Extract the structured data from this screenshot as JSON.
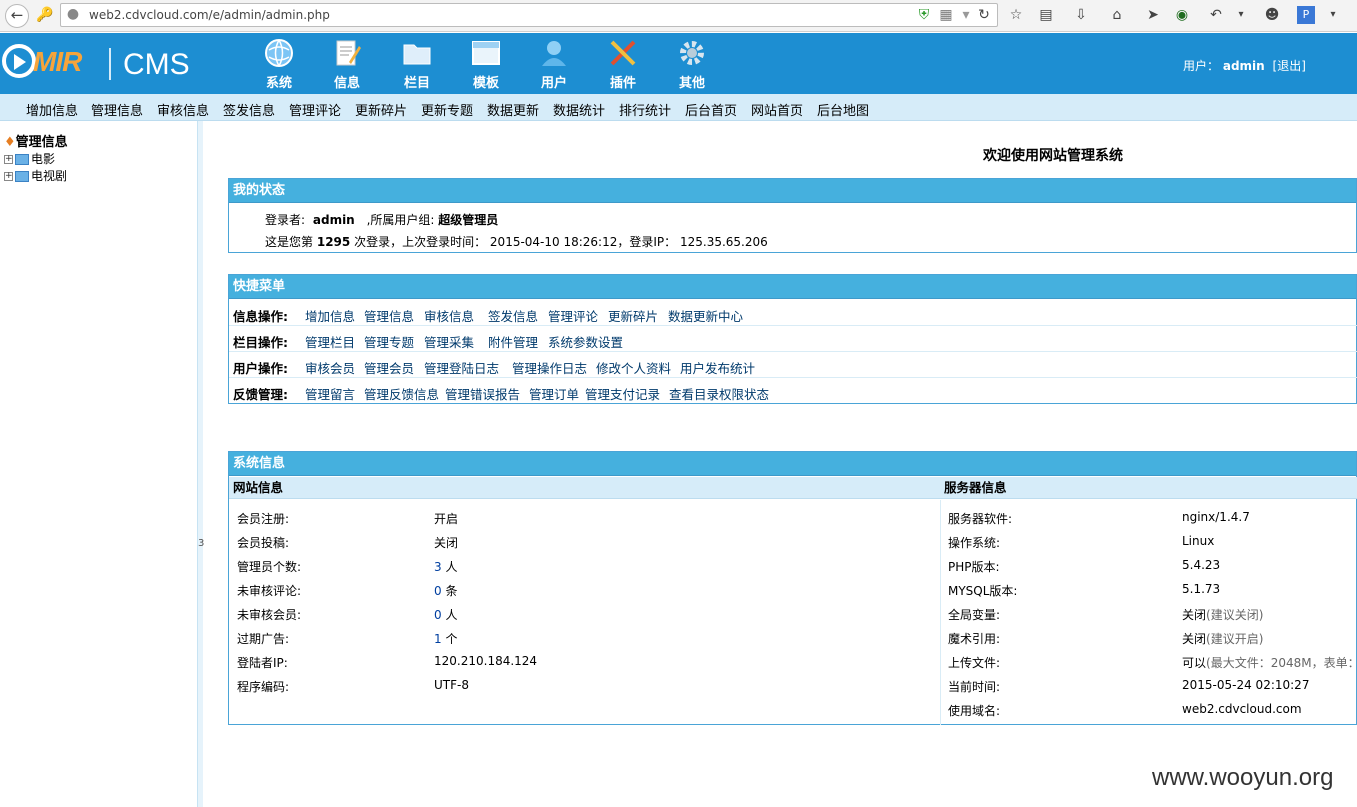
{
  "browser": {
    "url": "web2.cdvcloud.com/e/admin/admin.php",
    "back_icon": "back-arrow-icon",
    "icons": [
      "key-icon",
      "globe-icon",
      "shield-icon",
      "qrcode-icon",
      "dropdown-icon",
      "refresh-icon",
      "star-icon",
      "reader-icon",
      "download-icon",
      "home-icon",
      "send-icon",
      "extension-icon",
      "undo-icon",
      "dropdown-icon",
      "user-icon",
      "pinyin-icon",
      "menu-icon"
    ]
  },
  "header": {
    "logo_text": "MIR",
    "logo_cms": "CMS",
    "menus": [
      {
        "label": "系统",
        "icon": "globe-icon"
      },
      {
        "label": "信息",
        "icon": "document-edit-icon"
      },
      {
        "label": "栏目",
        "icon": "folder-icon"
      },
      {
        "label": "模板",
        "icon": "window-icon"
      },
      {
        "label": "用户",
        "icon": "user-icon"
      },
      {
        "label": "插件",
        "icon": "tools-icon"
      },
      {
        "label": "其他",
        "icon": "gear-icon"
      }
    ],
    "user_label": "用户：",
    "user_name": "admin",
    "logout": "[退出]"
  },
  "subnav": [
    "增加信息",
    "管理信息",
    "审核信息",
    "签发信息",
    "管理评论",
    "更新碎片",
    "更新专题",
    "数据更新",
    "数据统计",
    "排行统计",
    "后台首页",
    "网站首页",
    "后台地图"
  ],
  "tree": {
    "root": "管理信息",
    "nodes": [
      "电影",
      "电视剧"
    ]
  },
  "splitter_char": "3",
  "welcome": "欢迎使用网站管理系统",
  "my_status": {
    "title": "我的状态",
    "login_label": "登录者:",
    "user": "admin",
    "group_label": ",所属用户组:",
    "group": "超级管理员",
    "count_prefix": "这是您第",
    "count": "1295",
    "count_suffix": "次登录，上次登录时间：",
    "last_time": "2015-04-10 18:26:12",
    "ip_label": "，登录IP：",
    "last_ip": "125.35.65.206"
  },
  "quick_menu": {
    "title": "快捷菜单",
    "rows": [
      {
        "label": "信息操作:",
        "links": [
          "增加信息",
          "管理信息",
          "审核信息",
          "签发信息",
          "管理评论",
          "更新碎片",
          "数据更新中心"
        ]
      },
      {
        "label": "栏目操作:",
        "links": [
          "管理栏目",
          "管理专题",
          "管理采集",
          "附件管理",
          "系统参数设置"
        ]
      },
      {
        "label": "用户操作:",
        "links": [
          "审核会员",
          "管理会员",
          "管理登陆日志",
          "管理操作日志",
          "修改个人资料",
          "用户发布统计"
        ]
      },
      {
        "label": "反馈管理:",
        "links": [
          "管理留言",
          "管理反馈信息",
          "管理错误报告",
          "管理订单",
          "管理支付记录",
          "查看目录权限状态"
        ]
      }
    ]
  },
  "system_info": {
    "title": "系统信息",
    "site_head": "网站信息",
    "server_head": "服务器信息",
    "site": [
      {
        "k": "会员注册:",
        "v": "开启",
        "u": ""
      },
      {
        "k": "会员投稿:",
        "v": "关闭",
        "u": ""
      },
      {
        "k": "管理员个数:",
        "v": "3",
        "u": "人"
      },
      {
        "k": "未审核评论:",
        "v": "0",
        "u": "条"
      },
      {
        "k": "未审核会员:",
        "v": "0",
        "u": "人"
      },
      {
        "k": "过期广告:",
        "v": "1",
        "u": "个"
      },
      {
        "k": "登陆者IP:",
        "v": "120.210.184.124",
        "u": ""
      },
      {
        "k": "程序编码:",
        "v": "UTF-8",
        "u": ""
      }
    ],
    "server": [
      {
        "k": "服务器软件:",
        "v": "nginx/1.4.7",
        "n": ""
      },
      {
        "k": "操作系统:",
        "v": "Linux",
        "n": ""
      },
      {
        "k": "PHP版本:",
        "v": "5.4.23",
        "n": ""
      },
      {
        "k": "MYSQL版本:",
        "v": "5.1.73",
        "n": ""
      },
      {
        "k": "全局变量:",
        "v": "关闭",
        "n": "(建议关闭)"
      },
      {
        "k": "魔术引用:",
        "v": "关闭",
        "n": "(建议开启)"
      },
      {
        "k": "上传文件:",
        "v": "可以",
        "n": "(最大文件：2048M，表单："
      },
      {
        "k": "当前时间:",
        "v": "2015-05-24 02:10:27",
        "n": ""
      },
      {
        "k": "使用域名:",
        "v": "web2.cdvcloud.com",
        "n": ""
      }
    ]
  },
  "watermark": "www.wooyun.org",
  "colors": {
    "banner": "#1d8ed2",
    "panel_head": "#45b0de",
    "subnav": "#d6ecf9",
    "link": "#003a6c"
  }
}
